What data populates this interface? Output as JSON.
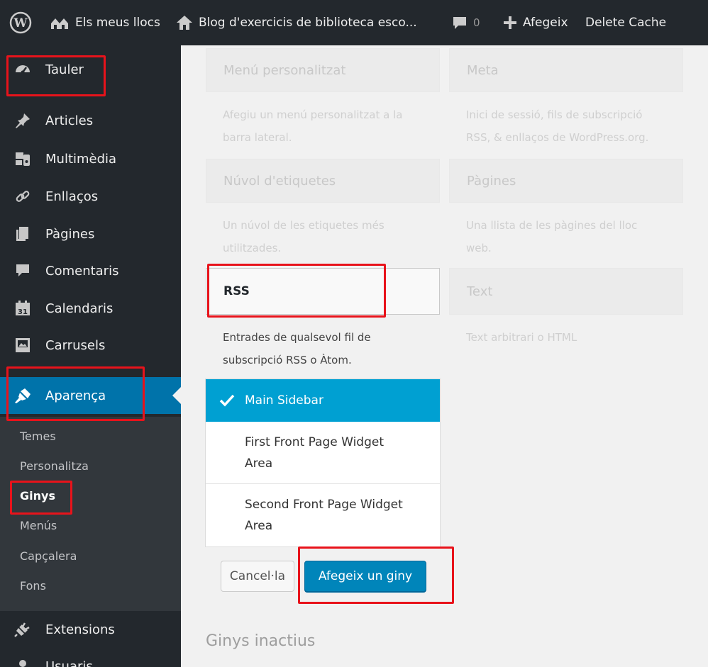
{
  "admin_bar": {
    "my_sites": "Els meus llocs",
    "site_name": "Blog d'exercicis de biblioteca esco...",
    "comments_count": "0",
    "add_new": "Afegeix",
    "delete_cache": "Delete Cache"
  },
  "sidebar": {
    "items": [
      {
        "label": "Tauler",
        "icon": "dashboard-icon"
      },
      {
        "label": "Articles",
        "icon": "pin-icon"
      },
      {
        "label": "Multimèdia",
        "icon": "media-icon"
      },
      {
        "label": "Enllaços",
        "icon": "link-icon"
      },
      {
        "label": "Pàgines",
        "icon": "pages-icon"
      },
      {
        "label": "Comentaris",
        "icon": "comment-icon"
      },
      {
        "label": "Calendaris",
        "icon": "calendar-icon"
      },
      {
        "label": "Carrusels",
        "icon": "carousel-icon"
      },
      {
        "label": "Aparença",
        "icon": "appearance-icon"
      }
    ],
    "submenu": [
      "Temes",
      "Personalitza",
      "Ginys",
      "Menús",
      "Capçalera",
      "Fons"
    ],
    "after": [
      {
        "label": "Extensions",
        "icon": "plugins-icon"
      },
      {
        "label": "Usuaris",
        "icon": "users-icon"
      }
    ]
  },
  "widgets": {
    "custom_menu": {
      "title": "Menú personalitzat",
      "desc_line1": "Afegiu un menú personalitzat a la",
      "desc_line2": "barra lateral."
    },
    "meta": {
      "title": "Meta",
      "desc_line1": "Inici de sessió, fils de subscripció",
      "desc_line2": "RSS, & enllaços de WordPress.org."
    },
    "tag_cloud": {
      "title": "Núvol d'etiquetes",
      "desc_line1": "Un núvol de les etiquetes més",
      "desc_line2": "utilitzades."
    },
    "pages": {
      "title": "Pàgines",
      "desc_line1": "Una llista de les pàgines del lloc",
      "desc_line2": "web."
    },
    "rss": {
      "title": "RSS",
      "desc_line1": "Entrades de qualsevol fil de",
      "desc_line2": "subscripció RSS o Àtom."
    },
    "text": {
      "title": "Text",
      "desc_line1": "Text arbitrari o HTML"
    }
  },
  "chooser": {
    "options": [
      {
        "line1": "Main Sidebar",
        "line2": ""
      },
      {
        "line1": "First Front Page Widget",
        "line2": "Area"
      },
      {
        "line1": "Second Front Page Widget",
        "line2": "Area"
      }
    ],
    "cancel_label": "Cancel·la",
    "add_label": "Afegeix un giny"
  },
  "inactive_title": "Ginys inactius",
  "colors": {
    "adminbar": "#23282d",
    "active_menu": "#0073aa",
    "selected_option": "#00a0d2",
    "primary_button": "#0085ba",
    "highlight": "#e8131b"
  }
}
